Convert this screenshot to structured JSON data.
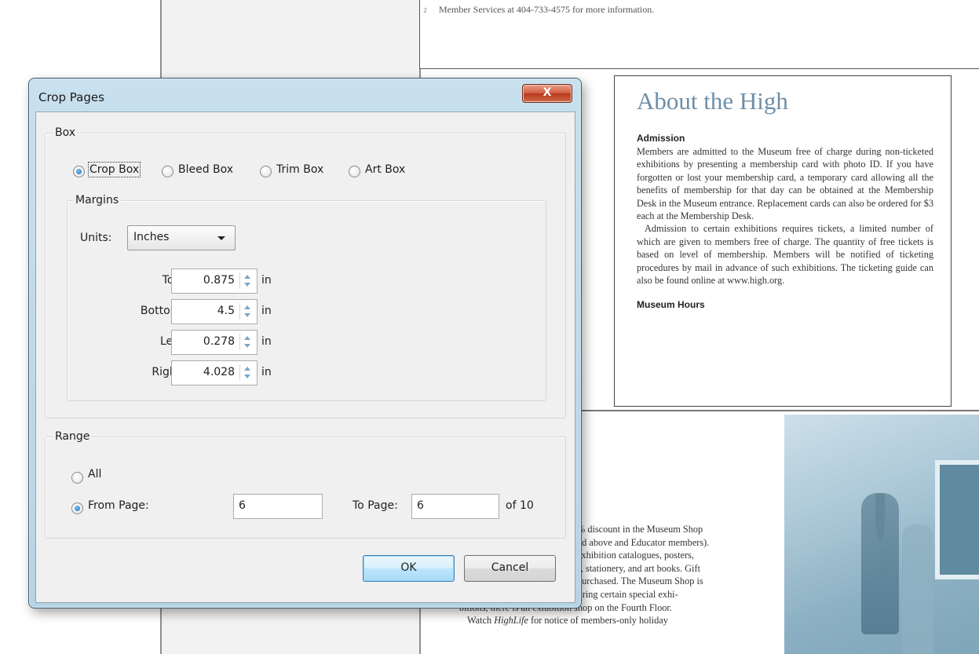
{
  "background": {
    "top_page_text": "Member Services at 404-733-4575 for more information.",
    "top_page_number": "2",
    "about": {
      "heading": "About the High",
      "subheading": "Admission",
      "paragraph1": "Members are admitted to the Museum free of charge during non-ticketed exhibitions by presenting a membership card with photo ID. If you have forgotten or lost your membership card, a temporary card allowing all the benefits of membership for that day can be obtained at the Membership Desk in the Museum entrance. Replacement cards can also be ordered for $3 each at the Membership Desk.",
      "paragraph2": "Admission to certain exhibitions requires tickets, a limited number of which are given to members free of charge. The quantity of free tickets is based on level of membership. Members will be notified of ticketing procedures by mail in advance of such exhibitions. The ticketing guide can also be found online at www.high.org.",
      "section2": "Museum Hours"
    },
    "shop": {
      "lines": [
        "% discount in the Museum Shop",
        "nd above and Educator members).",
        "exhibition catalogues, posters,",
        "s, stationery, and art books. Gift",
        "purchased. The Museum Shop is",
        "open during Museum hours. During certain special exhi-",
        "bitions, there is an exhibition shop on the Fourth Floor."
      ],
      "last_pre": "Watch ",
      "last_em": "HighLife",
      "last_post": " for notice of members-only holiday"
    }
  },
  "dialog": {
    "title": "Crop Pages",
    "close_label": "X",
    "box_group": {
      "legend": "Box",
      "options": [
        "Crop Box",
        "Bleed Box",
        "Trim Box",
        "Art Box"
      ],
      "selected": "Crop Box"
    },
    "margins": {
      "legend": "Margins",
      "units_label": "Units:",
      "units_value": "Inches",
      "fields": [
        {
          "label": "Top:",
          "value": "0.875",
          "unit": "in"
        },
        {
          "label": "Bottom:",
          "value": "4.5",
          "unit": "in"
        },
        {
          "label": "Left:",
          "value": "0.278",
          "unit": "in"
        },
        {
          "label": "Right:",
          "value": "4.028",
          "unit": "in"
        }
      ]
    },
    "range": {
      "legend": "Range",
      "all_label": "All",
      "from_label": "From Page:",
      "from_value": "6",
      "to_label": "To Page:",
      "to_value": "6",
      "of_label": "of 10",
      "selected": "From Page:"
    },
    "ok_label": "OK",
    "cancel_label": "Cancel"
  },
  "colors": {
    "dialog_frame": "#b7d3e6",
    "heading_blue": "#6d8fa8",
    "close_red": "#d05a3c"
  }
}
